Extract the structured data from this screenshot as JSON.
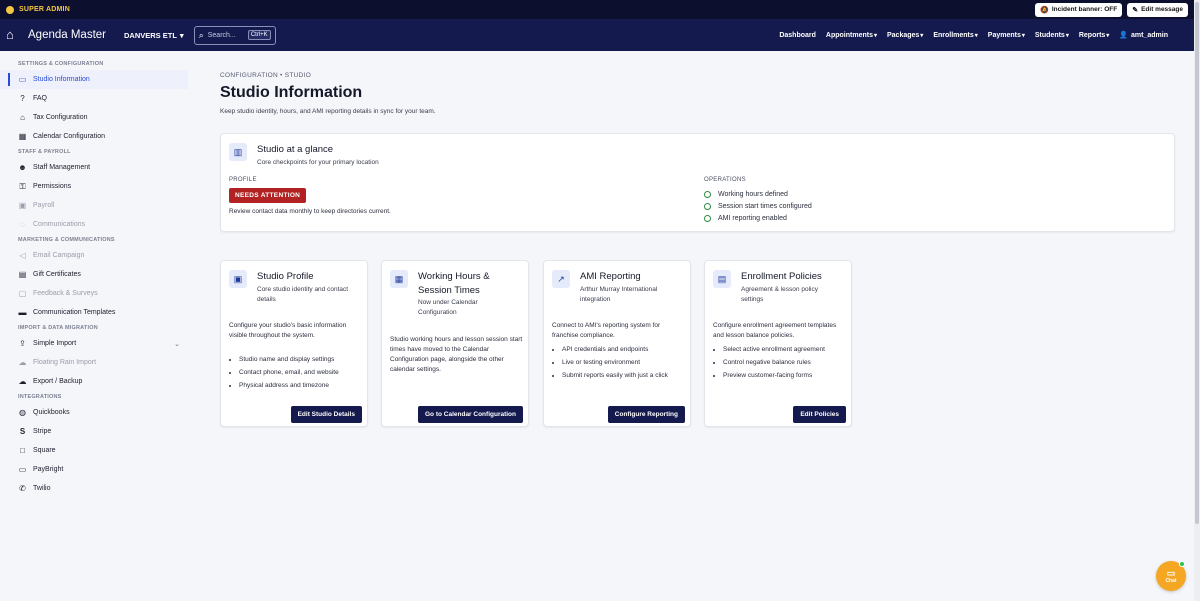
{
  "admin_bar": {
    "badge": "SUPER ADMIN",
    "incident_banner": "Incident banner: OFF",
    "edit_message": "Edit message"
  },
  "nav": {
    "brand": "Agenda Master",
    "studio": "DANVERS ETL",
    "search_placeholder": "Search...",
    "search_shortcut": "Ctrl+K",
    "links": [
      "Dashboard",
      "Appointments",
      "Packages",
      "Enrollments",
      "Payments",
      "Students",
      "Reports"
    ],
    "user": "amt_admin"
  },
  "sidebar": {
    "sections": [
      {
        "title": "SETTINGS & CONFIGURATION",
        "items": [
          {
            "label": "Studio Information",
            "icon": "id-card-icon",
            "state": "active"
          },
          {
            "label": "FAQ",
            "icon": "help-circle-icon"
          },
          {
            "label": "Tax Configuration",
            "icon": "bank-icon"
          },
          {
            "label": "Calendar Configuration",
            "icon": "calendar-icon"
          }
        ]
      },
      {
        "title": "STAFF & PAYROLL",
        "items": [
          {
            "label": "Staff Management",
            "icon": "people-icon"
          },
          {
            "label": "Permissions",
            "icon": "key-icon"
          },
          {
            "label": "Payroll",
            "icon": "payroll-icon",
            "state": "disabled"
          },
          {
            "label": "Communications",
            "icon": "chat-icon",
            "state": "disabled"
          }
        ]
      },
      {
        "title": "MARKETING & COMMUNICATIONS",
        "items": [
          {
            "label": "Email Campaign",
            "icon": "megaphone-icon",
            "state": "disabled"
          },
          {
            "label": "Gift Certificates",
            "icon": "gift-icon"
          },
          {
            "label": "Feedback & Surveys",
            "icon": "feedback-icon",
            "state": "disabled"
          },
          {
            "label": "Communication Templates",
            "icon": "template-icon"
          }
        ]
      },
      {
        "title": "IMPORT & DATA MIGRATION",
        "items": [
          {
            "label": "Simple Import",
            "icon": "upload-icon",
            "expandable": true
          },
          {
            "label": "Floating Rain Import",
            "icon": "cloud-download-icon",
            "state": "disabled"
          },
          {
            "label": "Export / Backup",
            "icon": "cloud-upload-icon"
          }
        ]
      },
      {
        "title": "INTEGRATIONS",
        "items": [
          {
            "label": "Quickbooks",
            "icon": "quickbooks-icon"
          },
          {
            "label": "Stripe",
            "icon": "stripe-icon"
          },
          {
            "label": "Square",
            "icon": "square-icon"
          },
          {
            "label": "PayBright",
            "icon": "cart-icon"
          },
          {
            "label": "Twilio",
            "icon": "phone-icon"
          }
        ]
      }
    ]
  },
  "page": {
    "breadcrumb": "CONFIGURATION • STUDIO",
    "title": "Studio Information",
    "subtitle": "Keep studio identity, hours, and AMI reporting details in sync for your team."
  },
  "glance": {
    "title": "Studio at a glance",
    "subtitle": "Core checkpoints for your primary location",
    "profile_label": "PROFILE",
    "status": "NEEDS ATTENTION",
    "note": "Review contact data monthly to keep directories current.",
    "operations_label": "OPERATIONS",
    "operations": [
      "Working hours defined",
      "Session start times configured",
      "AMI reporting enabled"
    ]
  },
  "cards": [
    {
      "title": "Studio Profile",
      "subtitle": "Core studio identity and contact details",
      "description": "Configure your studio's basic information visible throughout the system.",
      "bullets": [
        "Studio name and display settings",
        "Contact phone, email, and website",
        "Physical address and timezone"
      ],
      "button": "Edit Studio Details"
    },
    {
      "title": "Working Hours & Session Times",
      "subtitle": "Now under Calendar Configuration",
      "description": "Studio working hours and lesson session start times have moved to the Calendar Configuration page, alongside the other calendar settings.",
      "bullets": [],
      "button": "Go to Calendar Configuration"
    },
    {
      "title": "AMI Reporting",
      "subtitle": "Arthur Murray International integration",
      "description": "Connect to AMI's reporting system for franchise compliance.",
      "bullets": [
        "API credentials and endpoints",
        "Live or testing environment",
        "Submit reports easily with just a click"
      ],
      "button": "Configure Reporting"
    },
    {
      "title": "Enrollment Policies",
      "subtitle": "Agreement & lesson policy settings",
      "description": "Configure enrollment agreement templates and lesson balance policies.",
      "bullets": [
        "Select active enrollment agreement",
        "Control negative balance rules",
        "Preview customer-facing forms"
      ],
      "button": "Edit Policies"
    }
  ],
  "chat": {
    "label": "Chat"
  }
}
